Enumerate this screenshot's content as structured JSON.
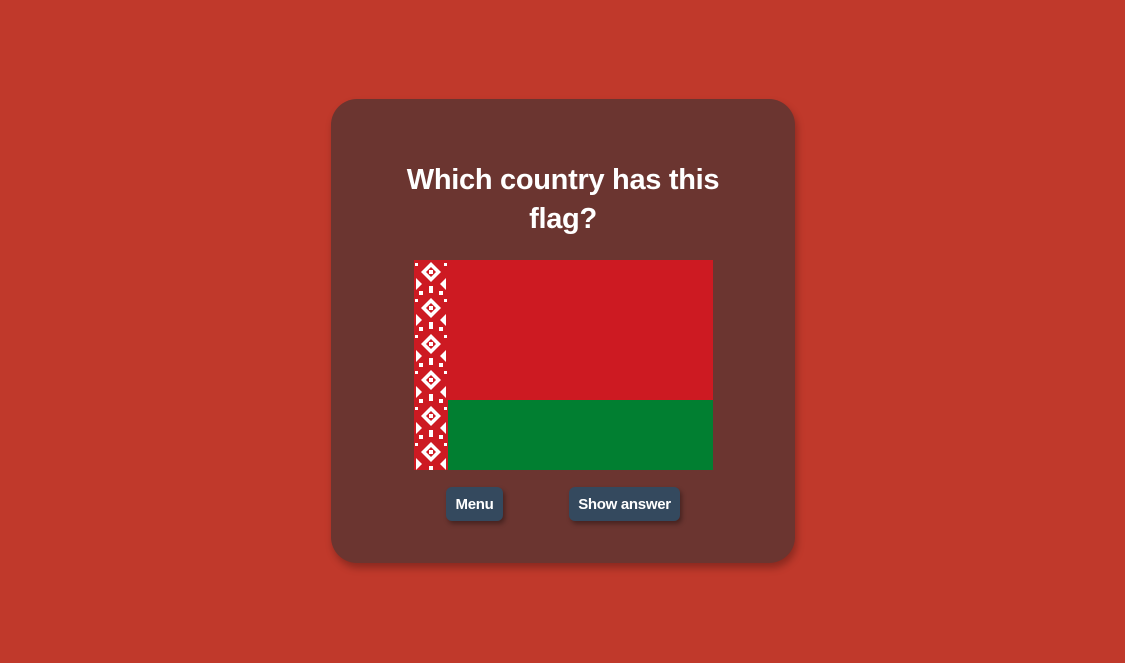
{
  "quiz": {
    "question": "Which country has this flag?",
    "flag": {
      "country_icon": "belarus-flag",
      "colors": {
        "red": "#cd1a22",
        "green": "#017f31",
        "ornament": "#ffffff"
      }
    },
    "buttons": {
      "menu_label": "Menu",
      "show_answer_label": "Show answer"
    }
  },
  "colors": {
    "page_background": "#c0392b",
    "card_background": "#6b3530",
    "button_background": "#34495e",
    "text": "#ffffff"
  }
}
